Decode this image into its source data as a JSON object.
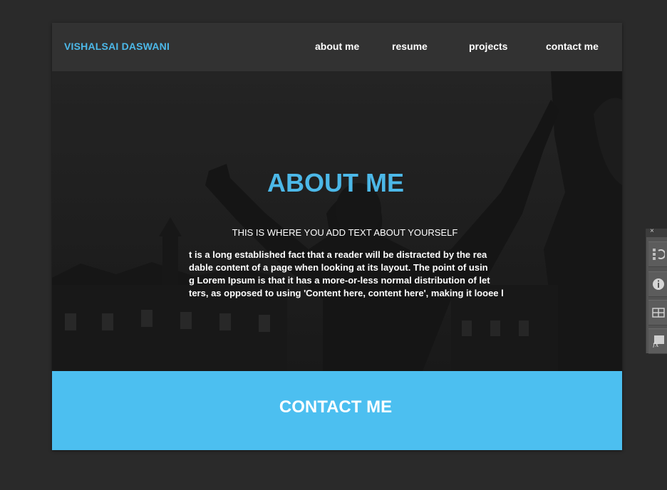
{
  "site": {
    "brand": "VISHALSAI DASWANI",
    "nav": [
      "about me",
      "resume",
      "projects",
      "contact me"
    ]
  },
  "hero": {
    "title": "ABOUT ME",
    "subtitle": "THIS IS WHERE YOU ADD TEXT ABOUT YOURSELF",
    "body_lines": [
      "t is a long established fact that a reader will be distracted by the rea",
      "dable content of a page when looking at its layout. The point of usin",
      "g Lorem Ipsum is that it has a more-or-less normal distribution of let",
      "ters, as opposed to using 'Content here, content here', making it looee l"
    ]
  },
  "contact": {
    "title": "CONTACT ME"
  },
  "tool_panel": {
    "close_glyph": "×",
    "buttons": [
      "history-icon",
      "info-icon",
      "swatches-icon",
      "styles-icon"
    ]
  },
  "colors": {
    "accent": "#4cb8e8",
    "contact_bg": "#4cbff0",
    "workspace": "#2a2a2a",
    "topbar": "#323232"
  }
}
